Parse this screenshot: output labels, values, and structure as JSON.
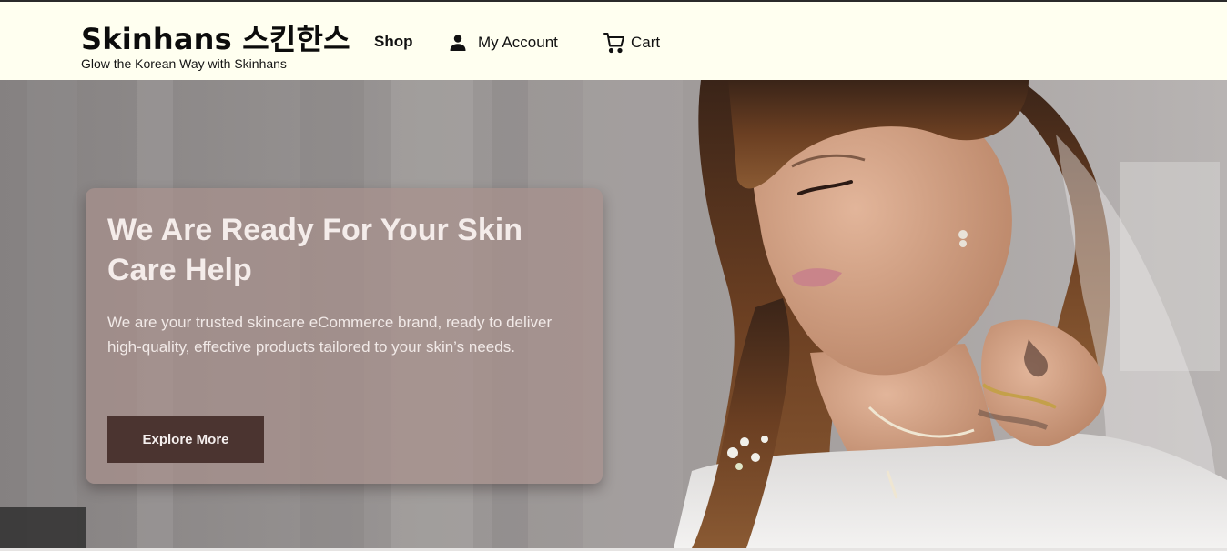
{
  "header": {
    "brand": "Skinhans 스킨한스",
    "tagline": "Glow the Korean Way with Skinhans",
    "nav": {
      "shop": "Shop",
      "account": "My Account",
      "cart": "Cart"
    }
  },
  "icons": {
    "account": "user-icon",
    "cart": "cart-icon"
  },
  "hero": {
    "heading": "We Are Ready For Your Skin Care Help",
    "text": "We are your trusted skincare eCommerce brand, ready to deliver high-quality, effective products tailored to your skin’s needs.",
    "button": "Explore More",
    "image": "hero-photo"
  },
  "colors": {
    "header_bg": "#fffff0",
    "button_bg": "#4b3430",
    "card_bg": "#a8908c"
  }
}
